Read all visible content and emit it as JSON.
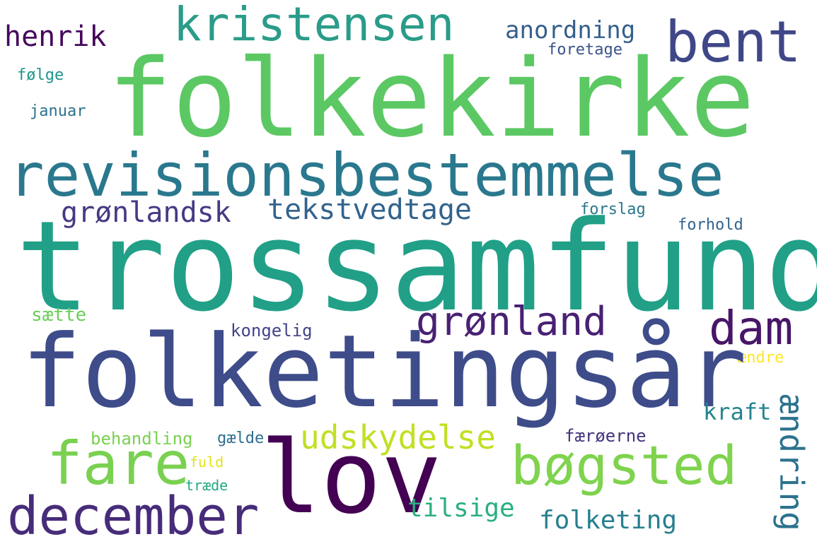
{
  "words": {
    "trossamfund": {
      "text": "trossamfund",
      "color": "#21a087"
    },
    "folkekirke": {
      "text": "folkekirke",
      "color": "#5cc863"
    },
    "folketingsar": {
      "text": "folketingsår",
      "color": "#3e4c8a"
    },
    "revisionsbestemmelse": {
      "text": "revisionsbestemmelse",
      "color": "#2a788e"
    },
    "lov": {
      "text": "lov",
      "color": "#440154"
    },
    "kristensen": {
      "text": "kristensen",
      "color": "#2a9c89"
    },
    "bent": {
      "text": "bent",
      "color": "#3f4788"
    },
    "fare": {
      "text": "fare",
      "color": "#7ad151"
    },
    "december": {
      "text": "december",
      "color": "#472c7a"
    },
    "bogsted": {
      "text": "bøgsted",
      "color": "#7fd34e"
    },
    "dam": {
      "text": "dam",
      "color": "#481668"
    },
    "gronland": {
      "text": "grønland",
      "color": "#482173"
    },
    "udskydelse": {
      "text": "udskydelse",
      "color": "#c2df23"
    },
    "tekstvedtage": {
      "text": "tekstvedtage",
      "color": "#33638d"
    },
    "gronlandsk": {
      "text": "grønlandsk",
      "color": "#443a83"
    },
    "henrik": {
      "text": "henrik",
      "color": "#46085c"
    },
    "anordning": {
      "text": "anordning",
      "color": "#355f8d"
    },
    "aendring": {
      "text": "ændring",
      "color": "#2c728e"
    },
    "tilsige": {
      "text": "tilsige",
      "color": "#2ab07f"
    },
    "folketing": {
      "text": "folketing",
      "color": "#277f8e"
    },
    "kraft": {
      "text": "kraft",
      "color": "#25848e"
    },
    "foretage": {
      "text": "foretage",
      "color": "#3b528b"
    },
    "folge": {
      "text": "følge",
      "color": "#1f968b"
    },
    "januar": {
      "text": "januar",
      "color": "#2c728e"
    },
    "forslag": {
      "text": "forslag",
      "color": "#2a788e"
    },
    "forhold": {
      "text": "forhold",
      "color": "#33638d"
    },
    "saette": {
      "text": "sætte",
      "color": "#6ccd5a"
    },
    "kongelig": {
      "text": "kongelig",
      "color": "#414487"
    },
    "aendre": {
      "text": "ændre",
      "color": "#fde725"
    },
    "behandling": {
      "text": "behandling",
      "color": "#7ad151"
    },
    "gaelde": {
      "text": "gælde",
      "color": "#2e6e8e"
    },
    "faeroerne": {
      "text": "færøerne",
      "color": "#46337e"
    },
    "fuld": {
      "text": "fuld",
      "color": "#e2e418"
    },
    "traede": {
      "text": "træde",
      "color": "#22a884"
    }
  }
}
